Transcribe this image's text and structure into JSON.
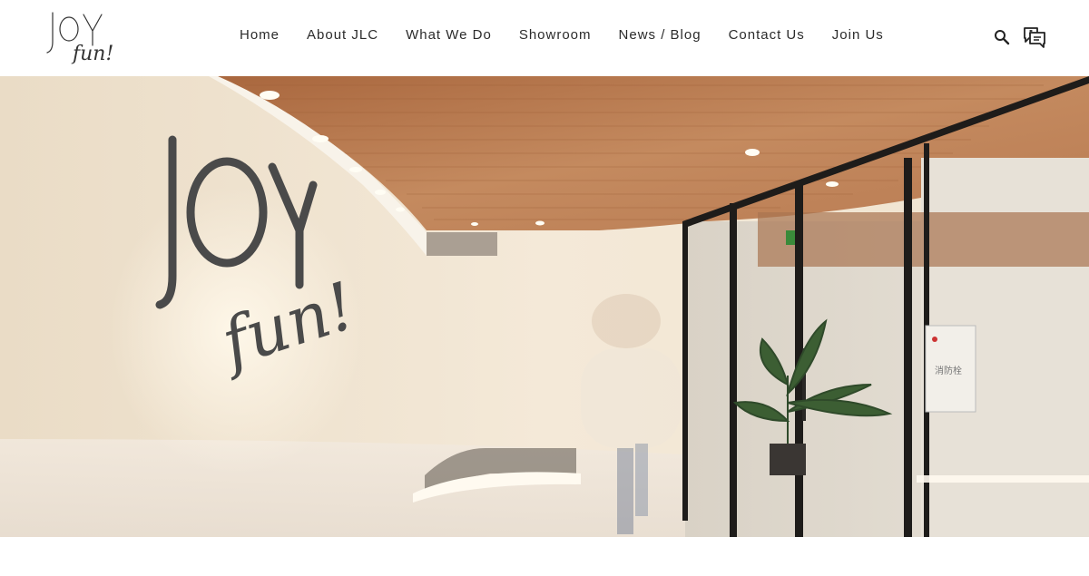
{
  "header": {
    "logo_text": [
      "JOY",
      "fun!"
    ],
    "nav": [
      {
        "label": "Home"
      },
      {
        "label": "About JLC"
      },
      {
        "label": "What We Do"
      },
      {
        "label": "Showroom"
      },
      {
        "label": "News / Blog"
      },
      {
        "label": "Contact Us"
      },
      {
        "label": "Join Us"
      }
    ],
    "icons": {
      "search": "search-icon",
      "chat": "chat-icon"
    }
  },
  "hero": {
    "image_description_free": true,
    "wall_sign_text": [
      "JOY",
      "fun!"
    ],
    "fire_hydrant_label": "消防栓"
  },
  "colors": {
    "nav_text": "#2b2b2b",
    "wood_ceiling": "#b5764c",
    "wall": "#efe3cf"
  }
}
